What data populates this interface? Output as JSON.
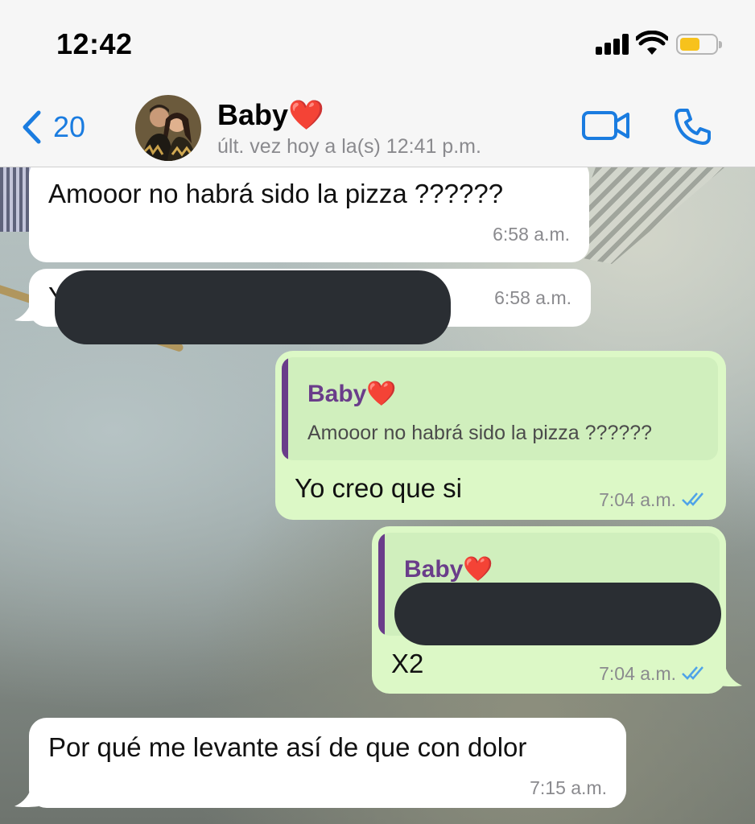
{
  "status_bar": {
    "time": "12:42"
  },
  "header": {
    "back_count": "20",
    "contact_name": "Baby",
    "contact_emoji": "❤️",
    "last_seen": "últ. vez hoy a la(s) 12:41 p.m."
  },
  "messages": [
    {
      "direction": "incoming",
      "text": "Amooor no habrá sido la pizza ??????",
      "time": "6:58 a.m."
    },
    {
      "direction": "incoming",
      "text": "Y",
      "time": "6:58 a.m.",
      "redacted": true
    },
    {
      "direction": "outgoing",
      "reply_to": {
        "name": "Baby",
        "emoji": "❤️",
        "text": "Amooor no habrá sido la pizza ??????"
      },
      "text": "Yo creo que si",
      "time": "7:04 a.m.",
      "status": "read"
    },
    {
      "direction": "outgoing",
      "reply_to": {
        "name": "Baby",
        "emoji": "❤️",
        "text": "",
        "redacted": true
      },
      "text": "X2",
      "time": "7:04 a.m.",
      "status": "read"
    },
    {
      "direction": "incoming",
      "text": "Por qué me levante así de que con dolor",
      "time": "7:15 a.m."
    }
  ],
  "colors": {
    "accent": "#1a7ce0",
    "incoming_bubble": "#ffffff",
    "outgoing_bubble": "#dcf8c6",
    "quote_name": "#6a3d8a",
    "read_ticks": "#4fa3e8"
  },
  "icons": [
    "back-chevron-icon",
    "video-call-icon",
    "phone-call-icon",
    "signal-icon",
    "wifi-icon",
    "battery-icon",
    "read-ticks-icon"
  ]
}
